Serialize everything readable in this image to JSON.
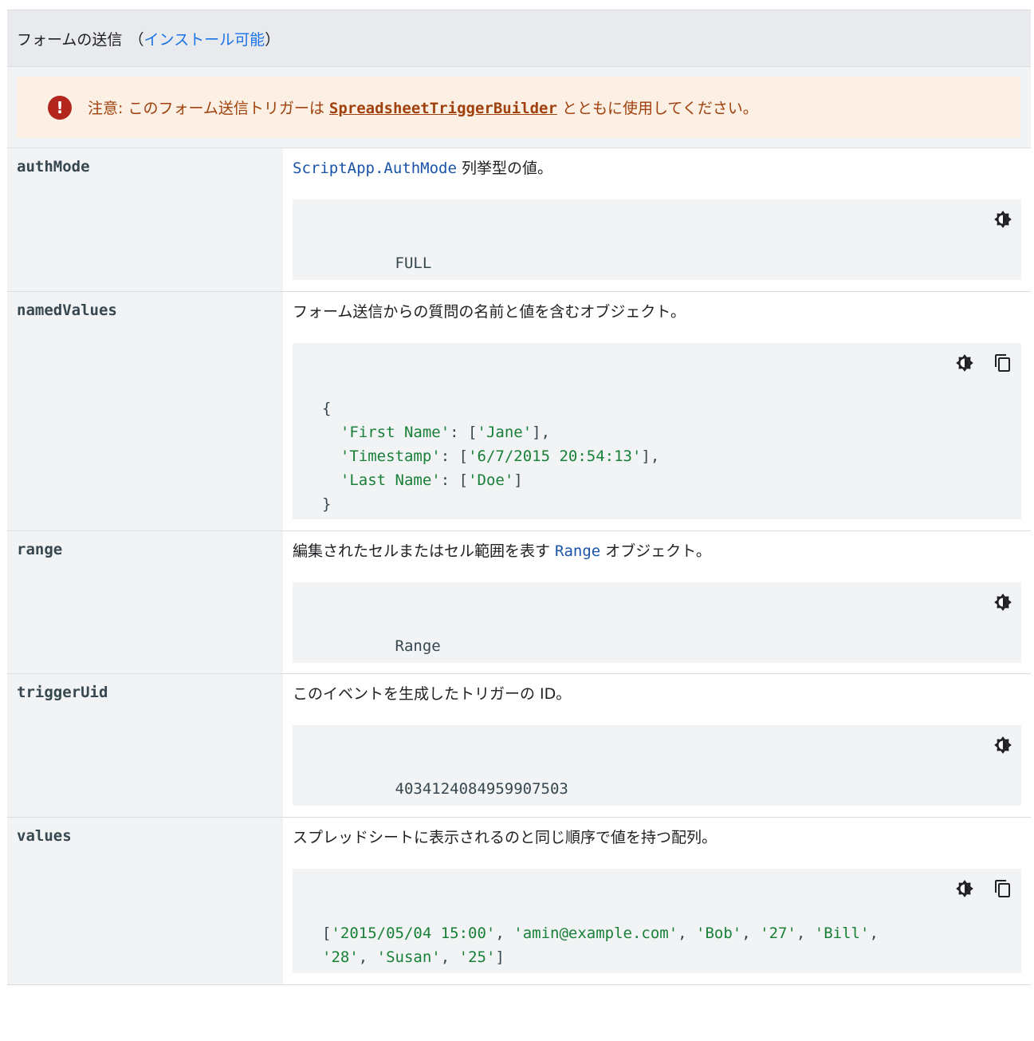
{
  "header": {
    "title": "フォームの送信",
    "paren_open": "（",
    "link": "インストール可能",
    "paren_close": "）"
  },
  "caution": {
    "label": "注意:",
    "text_before": " このフォーム送信トリガーは ",
    "link": "SpreadsheetTriggerBuilder",
    "text_after": " とともに使用してください。"
  },
  "rows": [
    {
      "name": "authMode",
      "desc_code": "ScriptApp.AuthMode",
      "desc_after": " 列挙型の値。",
      "code": "FULL"
    },
    {
      "name": "namedValues",
      "desc": "フォーム送信からの質問の名前と値を含むオブジェクト。",
      "code_lines": [
        "{",
        "  'First Name': ['Jane'],",
        "  'Timestamp': ['6/7/2015 20:54:13'],",
        "  'Last Name': ['Doe']",
        "}"
      ]
    },
    {
      "name": "range",
      "desc_before": "編集されたセルまたはセル範囲を表す ",
      "desc_code": "Range",
      "desc_after": " オブジェクト。",
      "code": "Range"
    },
    {
      "name": "triggerUid",
      "desc": "このイベントを生成したトリガーの ID。",
      "code": "4034124084959907503"
    },
    {
      "name": "values",
      "desc": "スプレッドシートに表示されるのと同じ順序で値を持つ配列。",
      "code_lines": [
        "['2015/05/04 15:00', 'amin@example.com', 'Bob', '27', 'Bill',",
        "'28', 'Susan', '25']"
      ]
    }
  ],
  "icons": {
    "theme": "dark-mode-toggle-icon",
    "copy": "copy-icon",
    "caution": "exclamation-icon"
  },
  "colors": {
    "string": "#188038",
    "link": "#1a73e8",
    "caution_text": "#a0410d",
    "caution_icon": "#b3261e"
  }
}
